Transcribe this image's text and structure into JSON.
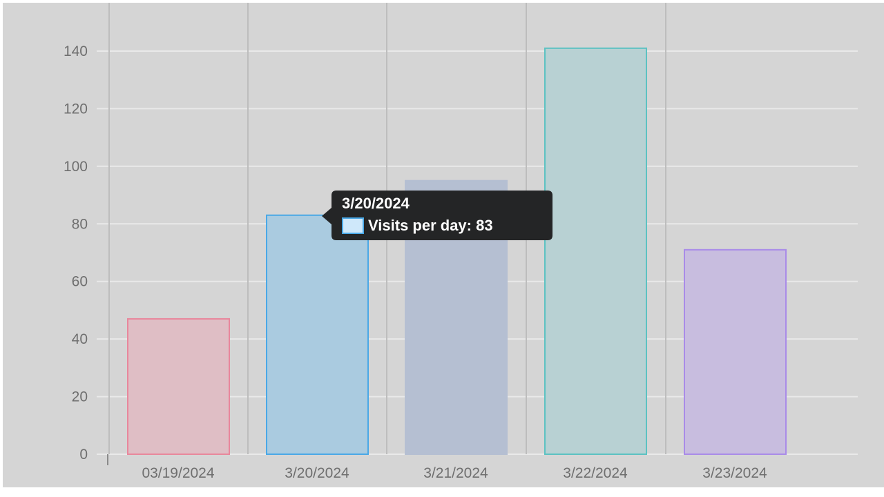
{
  "chart_data": {
    "type": "bar",
    "categories": [
      "03/19/2024",
      "3/20/2024",
      "3/21/2024",
      "3/22/2024",
      "3/23/2024"
    ],
    "series": [
      {
        "name": "Visits per day",
        "values": [
          47,
          83,
          95,
          141,
          71
        ]
      }
    ],
    "bar_fill_colors": [
      "#dfbec5",
      "#aacbe0",
      "#b5bfd2",
      "#b8d1d3",
      "#c8bddf"
    ],
    "bar_border_colors": [
      "#e8879c",
      "#4aa8e6",
      "#b5bfd2",
      "#5cc2c2",
      "#a98be8"
    ],
    "ylim": [
      0,
      150
    ],
    "y_ticks": [
      0,
      20,
      40,
      60,
      80,
      100,
      120,
      140
    ],
    "title": "",
    "xlabel": "",
    "ylabel": "",
    "grid": true,
    "background_color": "#d5d5d5",
    "tooltip": {
      "visible": true,
      "category_index": 1,
      "title": "3/20/2024",
      "label": "Visits per day: 83",
      "swatch_color": "#cfe8fa",
      "swatch_border_color": "#4aa8e6",
      "background_color": "#242526"
    }
  }
}
